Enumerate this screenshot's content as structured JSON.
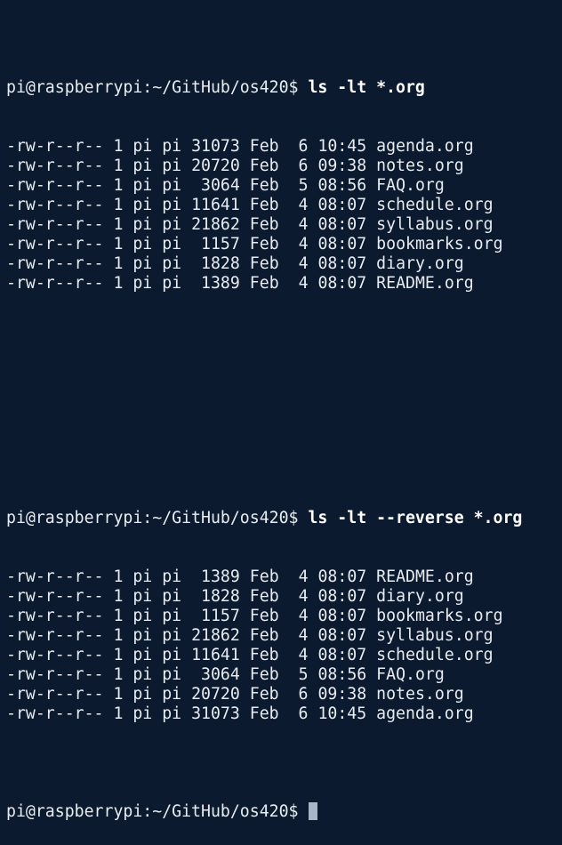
{
  "colors": {
    "background": "#0b1a2e",
    "text": "#e8ecf1",
    "command": "#ffffff",
    "cursor": "#a7b7c7"
  },
  "blocks": [
    {
      "prompt": "pi@raspberrypi:~/GitHub/os420$ ",
      "command": "ls -lt *.org",
      "rows": [
        {
          "perms": "-rw-r--r--",
          "links": "1",
          "owner": "pi",
          "group": "pi",
          "size": "31073",
          "month": "Feb",
          "day": "6",
          "time": "10:45",
          "name": "agenda.org"
        },
        {
          "perms": "-rw-r--r--",
          "links": "1",
          "owner": "pi",
          "group": "pi",
          "size": "20720",
          "month": "Feb",
          "day": "6",
          "time": "09:38",
          "name": "notes.org"
        },
        {
          "perms": "-rw-r--r--",
          "links": "1",
          "owner": "pi",
          "group": "pi",
          "size": "3064",
          "month": "Feb",
          "day": "5",
          "time": "08:56",
          "name": "FAQ.org"
        },
        {
          "perms": "-rw-r--r--",
          "links": "1",
          "owner": "pi",
          "group": "pi",
          "size": "11641",
          "month": "Feb",
          "day": "4",
          "time": "08:07",
          "name": "schedule.org"
        },
        {
          "perms": "-rw-r--r--",
          "links": "1",
          "owner": "pi",
          "group": "pi",
          "size": "21862",
          "month": "Feb",
          "day": "4",
          "time": "08:07",
          "name": "syllabus.org"
        },
        {
          "perms": "-rw-r--r--",
          "links": "1",
          "owner": "pi",
          "group": "pi",
          "size": "1157",
          "month": "Feb",
          "day": "4",
          "time": "08:07",
          "name": "bookmarks.org"
        },
        {
          "perms": "-rw-r--r--",
          "links": "1",
          "owner": "pi",
          "group": "pi",
          "size": "1828",
          "month": "Feb",
          "day": "4",
          "time": "08:07",
          "name": "diary.org"
        },
        {
          "perms": "-rw-r--r--",
          "links": "1",
          "owner": "pi",
          "group": "pi",
          "size": "1389",
          "month": "Feb",
          "day": "4",
          "time": "08:07",
          "name": "README.org"
        }
      ]
    },
    {
      "prompt": "pi@raspberrypi:~/GitHub/os420$ ",
      "command": "ls -lt --reverse *.org",
      "rows": [
        {
          "perms": "-rw-r--r--",
          "links": "1",
          "owner": "pi",
          "group": "pi",
          "size": "1389",
          "month": "Feb",
          "day": "4",
          "time": "08:07",
          "name": "README.org"
        },
        {
          "perms": "-rw-r--r--",
          "links": "1",
          "owner": "pi",
          "group": "pi",
          "size": "1828",
          "month": "Feb",
          "day": "4",
          "time": "08:07",
          "name": "diary.org"
        },
        {
          "perms": "-rw-r--r--",
          "links": "1",
          "owner": "pi",
          "group": "pi",
          "size": "1157",
          "month": "Feb",
          "day": "4",
          "time": "08:07",
          "name": "bookmarks.org"
        },
        {
          "perms": "-rw-r--r--",
          "links": "1",
          "owner": "pi",
          "group": "pi",
          "size": "21862",
          "month": "Feb",
          "day": "4",
          "time": "08:07",
          "name": "syllabus.org"
        },
        {
          "perms": "-rw-r--r--",
          "links": "1",
          "owner": "pi",
          "group": "pi",
          "size": "11641",
          "month": "Feb",
          "day": "4",
          "time": "08:07",
          "name": "schedule.org"
        },
        {
          "perms": "-rw-r--r--",
          "links": "1",
          "owner": "pi",
          "group": "pi",
          "size": "3064",
          "month": "Feb",
          "day": "5",
          "time": "08:56",
          "name": "FAQ.org"
        },
        {
          "perms": "-rw-r--r--",
          "links": "1",
          "owner": "pi",
          "group": "pi",
          "size": "20720",
          "month": "Feb",
          "day": "6",
          "time": "09:38",
          "name": "notes.org"
        },
        {
          "perms": "-rw-r--r--",
          "links": "1",
          "owner": "pi",
          "group": "pi",
          "size": "31073",
          "month": "Feb",
          "day": "6",
          "time": "10:45",
          "name": "agenda.org"
        }
      ]
    }
  ],
  "final_prompt": "pi@raspberrypi:~/GitHub/os420$ "
}
